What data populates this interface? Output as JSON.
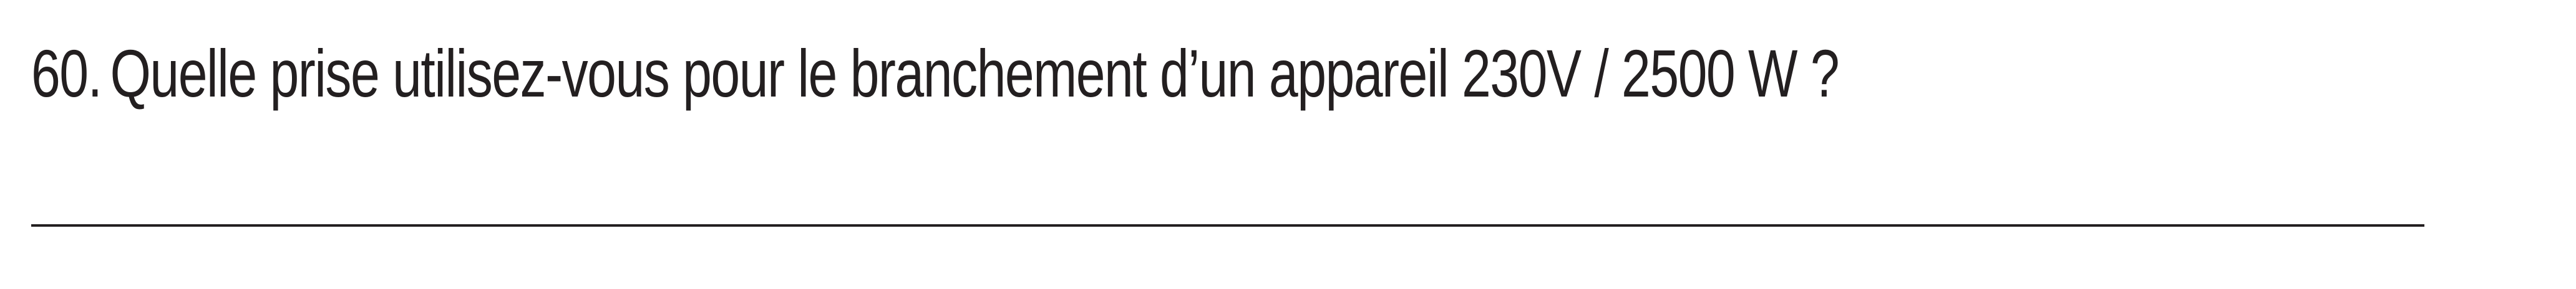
{
  "question": {
    "number": "60.",
    "text": "Quelle prise utilisez-vous pour le branchement d’un appareil 230V / 2500 W ?"
  }
}
